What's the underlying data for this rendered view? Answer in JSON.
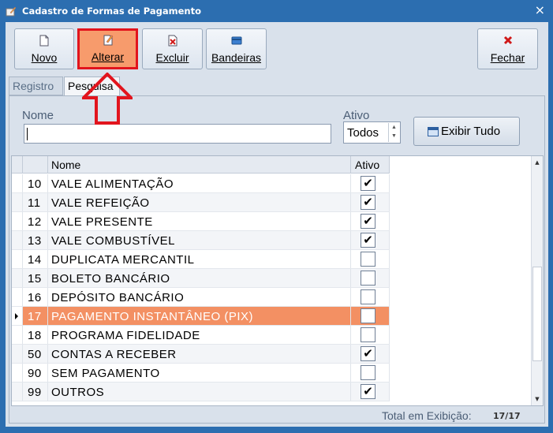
{
  "window": {
    "title": "Cadastro de Formas de Pagamento",
    "close_glyph": "×"
  },
  "toolbar": {
    "novo": "Novo",
    "alterar": "Alterar",
    "excluir": "Excluir",
    "bandeiras": "Bandeiras",
    "fechar": "Fechar"
  },
  "tabs": {
    "registro": "Registro",
    "pesquisa": "Pesquisa"
  },
  "filters": {
    "nome_label": "Nome",
    "nome_value": "",
    "ativo_label": "Ativo",
    "ativo_value": "Todos",
    "exibir_tudo": "Exibir Tudo"
  },
  "grid": {
    "col_nome": "Nome",
    "col_ativo": "Ativo",
    "rows": [
      {
        "code": "10",
        "name": "VALE ALIMENTAÇÃO",
        "ativo": "✔"
      },
      {
        "code": "11",
        "name": "VALE REFEIÇÃO",
        "ativo": "✔"
      },
      {
        "code": "12",
        "name": "VALE PRESENTE",
        "ativo": "✔"
      },
      {
        "code": "13",
        "name": "VALE COMBUSTÍVEL",
        "ativo": "✔"
      },
      {
        "code": "14",
        "name": "DUPLICATA MERCANTIL",
        "ativo": ""
      },
      {
        "code": "15",
        "name": "BOLETO BANCÁRIO",
        "ativo": ""
      },
      {
        "code": "16",
        "name": "DEPÓSITO BANCÁRIO",
        "ativo": ""
      },
      {
        "code": "17",
        "name": "PAGAMENTO INSTANTÂNEO (PIX)",
        "ativo": ""
      },
      {
        "code": "18",
        "name": "PROGRAMA FIDELIDADE",
        "ativo": ""
      },
      {
        "code": "50",
        "name": "CONTAS A RECEBER",
        "ativo": "✔"
      },
      {
        "code": "90",
        "name": "SEM PAGAMENTO",
        "ativo": ""
      },
      {
        "code": "99",
        "name": "OUTROS",
        "ativo": "✔"
      }
    ]
  },
  "status": {
    "label": "Total em Exibição:",
    "count": "17/17"
  },
  "colors": {
    "title_bg": "#2c6eb0",
    "selected_row": "#f39063",
    "highlight_border": "#e2141d"
  }
}
